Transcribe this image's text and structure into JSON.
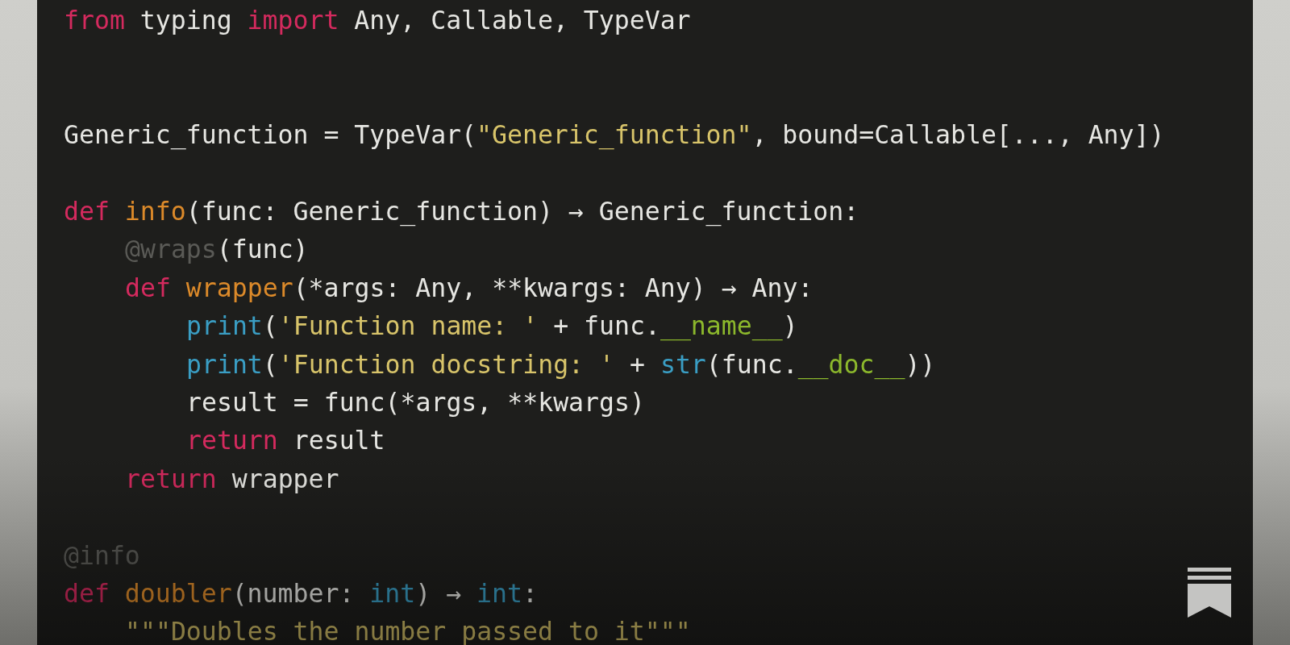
{
  "code": {
    "blocks": [
      {
        "lines": [
          {
            "tokens": [
              {
                "text": "from",
                "kind": "keyword"
              },
              {
                "text": " typing ",
                "kind": "plain"
              },
              {
                "text": "import",
                "kind": "keyword"
              },
              {
                "text": " Any, Callable, TypeVar",
                "kind": "plain"
              }
            ]
          }
        ]
      },
      {
        "lines": [
          {
            "tokens": [
              {
                "text": "Generic_function = TypeVar(",
                "kind": "plain"
              },
              {
                "text": "\"Generic_function\"",
                "kind": "string"
              },
              {
                "text": ", bound=Callable[..., Any])",
                "kind": "plain"
              }
            ]
          }
        ]
      },
      {
        "lines": [
          {
            "tokens": [
              {
                "text": "def ",
                "kind": "keyword"
              },
              {
                "text": "info",
                "kind": "name"
              },
              {
                "text": "(func: Generic_function) → Generic_function:",
                "kind": "plain"
              }
            ],
            "children": [
              {
                "tokens": [
                  {
                    "text": "@wraps",
                    "kind": "decorator"
                  },
                  {
                    "text": "(func)",
                    "kind": "plain"
                  }
                ]
              },
              {
                "tokens": [
                  {
                    "text": "def ",
                    "kind": "keyword"
                  },
                  {
                    "text": "wrapper",
                    "kind": "name"
                  },
                  {
                    "text": "(*args: Any, **kwargs: Any) → Any:",
                    "kind": "plain"
                  }
                ],
                "children": [
                  {
                    "tokens": [
                      {
                        "text": "print",
                        "kind": "builtin"
                      },
                      {
                        "text": "(",
                        "kind": "plain"
                      },
                      {
                        "text": "'Function name: '",
                        "kind": "string"
                      },
                      {
                        "text": " + func.",
                        "kind": "plain"
                      },
                      {
                        "text": "__name__",
                        "kind": "dunder"
                      },
                      {
                        "text": ")",
                        "kind": "plain"
                      }
                    ]
                  },
                  {
                    "tokens": [
                      {
                        "text": "print",
                        "kind": "builtin"
                      },
                      {
                        "text": "(",
                        "kind": "plain"
                      },
                      {
                        "text": "'Function docstring: '",
                        "kind": "string"
                      },
                      {
                        "text": " + ",
                        "kind": "plain"
                      },
                      {
                        "text": "str",
                        "kind": "builtin"
                      },
                      {
                        "text": "(func.",
                        "kind": "plain"
                      },
                      {
                        "text": "__doc__",
                        "kind": "dunder"
                      },
                      {
                        "text": "))",
                        "kind": "plain"
                      }
                    ]
                  },
                  {
                    "tokens": [
                      {
                        "text": "result = func(*args, **kwargs)",
                        "kind": "plain"
                      }
                    ]
                  },
                  {
                    "tokens": [
                      {
                        "text": "return",
                        "kind": "keyword"
                      },
                      {
                        "text": " result",
                        "kind": "plain"
                      }
                    ]
                  }
                ]
              },
              {
                "tokens": [
                  {
                    "text": "return",
                    "kind": "keyword"
                  },
                  {
                    "text": " wrapper",
                    "kind": "plain"
                  }
                ]
              }
            ]
          }
        ]
      },
      {
        "lines": [
          {
            "tokens": [
              {
                "text": "@info",
                "kind": "decorator"
              }
            ]
          },
          {
            "tokens": [
              {
                "text": "def ",
                "kind": "keyword"
              },
              {
                "text": "doubler",
                "kind": "name"
              },
              {
                "text": "(number: ",
                "kind": "plain"
              },
              {
                "text": "int",
                "kind": "builtin"
              },
              {
                "text": ") → ",
                "kind": "plain"
              },
              {
                "text": "int",
                "kind": "builtin"
              },
              {
                "text": ":",
                "kind": "plain"
              }
            ],
            "children": [
              {
                "tokens": [
                  {
                    "text": "\"\"\"Doubles the number passed to it\"\"\"",
                    "kind": "string"
                  }
                ]
              }
            ]
          }
        ]
      }
    ]
  }
}
